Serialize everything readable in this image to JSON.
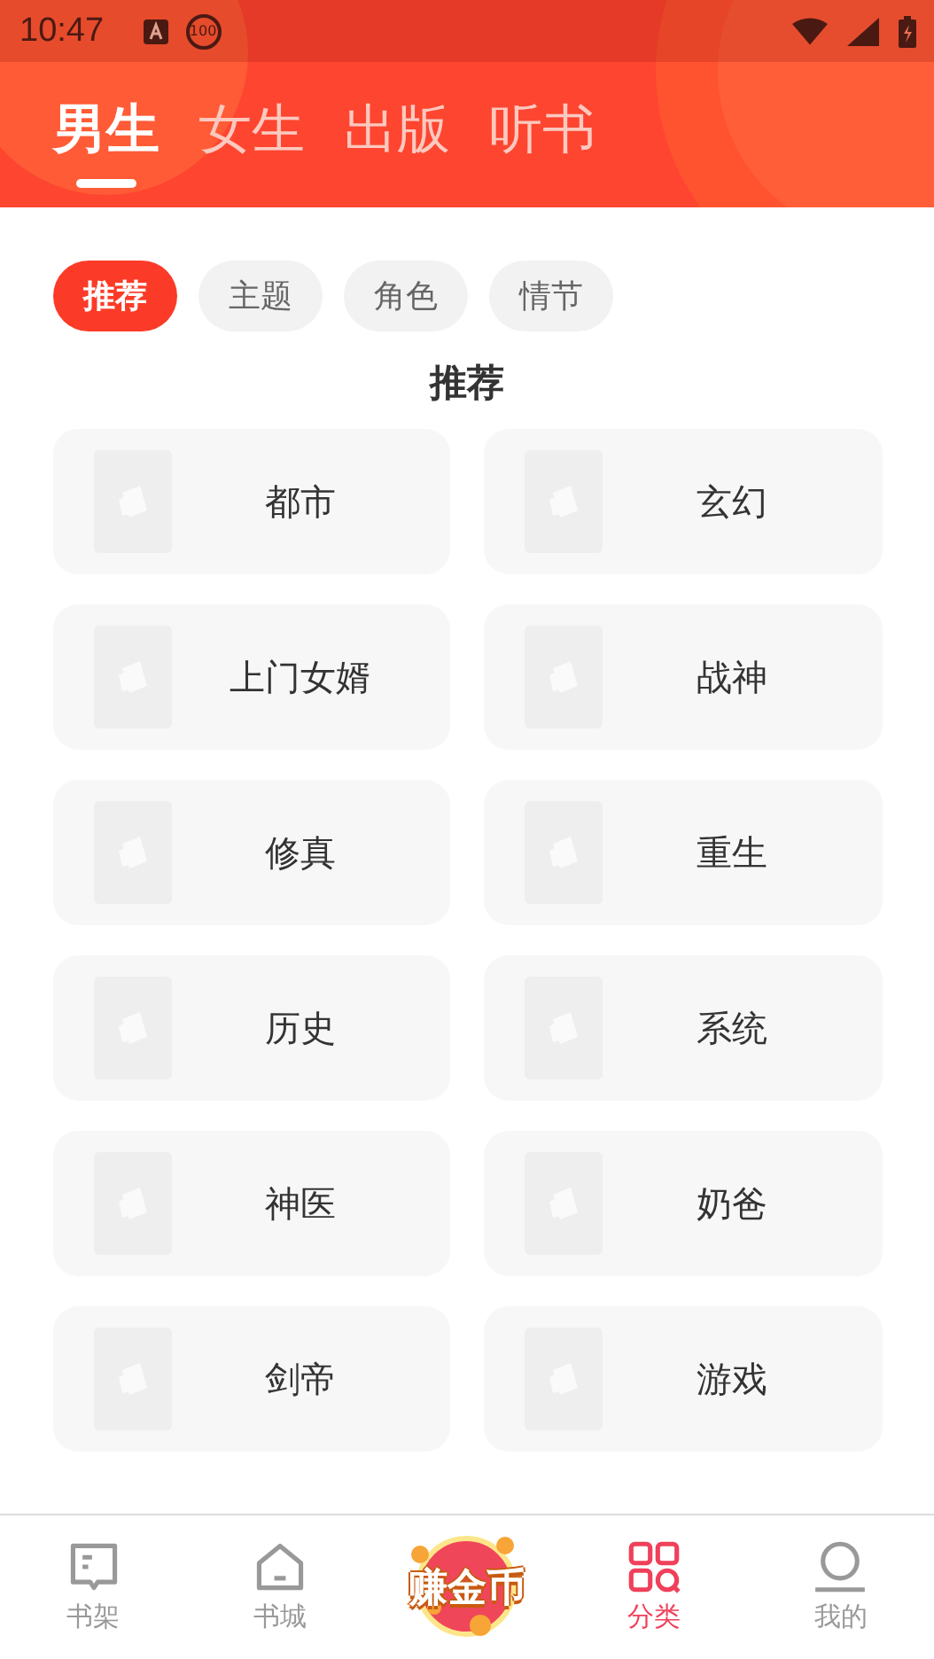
{
  "status_bar": {
    "time": "10:47",
    "badge": "100"
  },
  "top_tabs": [
    {
      "label": "男生",
      "selected": true
    },
    {
      "label": "女生",
      "selected": false
    },
    {
      "label": "出版",
      "selected": false
    },
    {
      "label": "听书",
      "selected": false
    }
  ],
  "filter_chips": [
    {
      "label": "推荐",
      "selected": true
    },
    {
      "label": "主题",
      "selected": false
    },
    {
      "label": "角色",
      "selected": false
    },
    {
      "label": "情节",
      "selected": false
    }
  ],
  "section_title": "推荐",
  "categories": [
    {
      "name": "都市"
    },
    {
      "name": "玄幻"
    },
    {
      "name": "上门女婿"
    },
    {
      "name": "战神"
    },
    {
      "name": "修真"
    },
    {
      "name": "重生"
    },
    {
      "name": "历史"
    },
    {
      "name": "系统"
    },
    {
      "name": "神医"
    },
    {
      "name": "奶爸"
    },
    {
      "name": "剑帝"
    },
    {
      "name": "游戏"
    }
  ],
  "bottom_nav": [
    {
      "kind": "shelf",
      "label": "书架",
      "selected": false
    },
    {
      "kind": "store",
      "label": "书城",
      "selected": false
    },
    {
      "kind": "coins",
      "label": "赚金币",
      "selected": false
    },
    {
      "kind": "category",
      "label": "分类",
      "selected": true
    },
    {
      "kind": "profile",
      "label": "我的",
      "selected": false
    }
  ]
}
